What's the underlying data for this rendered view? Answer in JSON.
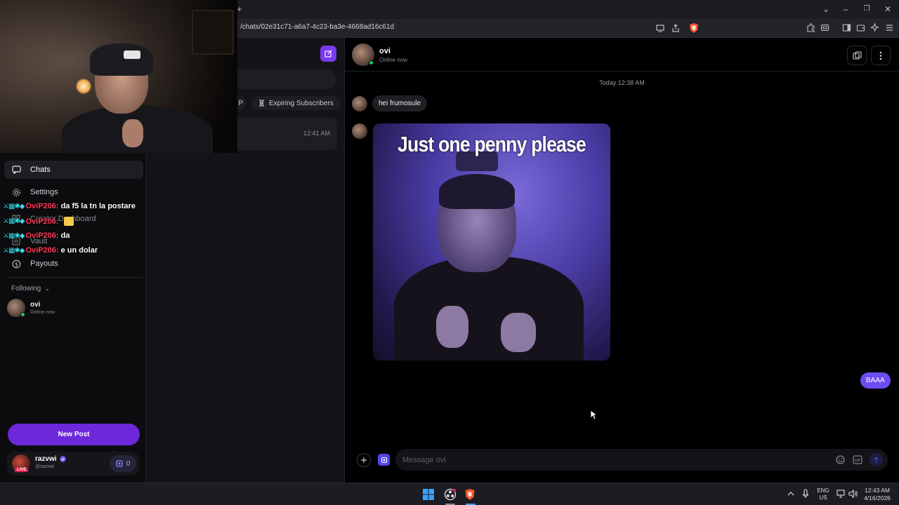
{
  "browser": {
    "url": "/chats/02e31c71-a6a7-4c23-ba3e-4668ad16c61d",
    "new_tab_symbol": "+",
    "window_controls": {
      "dropdown": "⌄",
      "minimize": "–",
      "restore": "❐",
      "close": "✕"
    }
  },
  "sidebar": {
    "items": [
      {
        "label": "Chats",
        "icon": "chat-icon"
      },
      {
        "label": "Settings",
        "icon": "gear-icon"
      },
      {
        "label": "Creator Dashboard",
        "icon": "dashboard-icon"
      },
      {
        "label": "Vault",
        "icon": "vault-icon"
      },
      {
        "label": "Payouts",
        "icon": "dollar-icon"
      }
    ],
    "following_label": "Following",
    "following": [
      {
        "name": "ovi",
        "status": "Online now"
      }
    ],
    "new_post_label": "New Post",
    "user": {
      "name": "razvwi",
      "handle": "@razvwi",
      "live_label": "LIVE",
      "coins": "0"
    }
  },
  "stream_chat": [
    {
      "user": "OviP206:",
      "message": "da f5 la tn la postare"
    },
    {
      "user": "OviP206:",
      "message": ""
    },
    {
      "user": "OviP206:",
      "message": "da"
    },
    {
      "user": "OviP206:",
      "message": "e un dolar"
    }
  ],
  "chat_list": {
    "filters": [
      "P",
      "Expiring Subscribers"
    ],
    "rows": [
      {
        "time": "12:41 AM"
      }
    ]
  },
  "conversation": {
    "contact_name": "ovi",
    "contact_status": "Online now",
    "day_stamp": "Today 12:38 AM",
    "messages": [
      {
        "direction": "in",
        "text": "hei frumosule"
      },
      {
        "direction": "in",
        "media_caption": "Just one penny please"
      },
      {
        "direction": "out",
        "text": "BAAA"
      }
    ],
    "composer_placeholder": "Message ovi"
  },
  "taskbar": {
    "language": "ENG",
    "region": "US",
    "time": "12:43 AM",
    "date": "4/16/2026"
  },
  "colors": {
    "accent": "#6d28d9",
    "outgoing_bubble": "#6d4df2",
    "online": "#22c55e",
    "chat_username": "#ff3d5a"
  }
}
